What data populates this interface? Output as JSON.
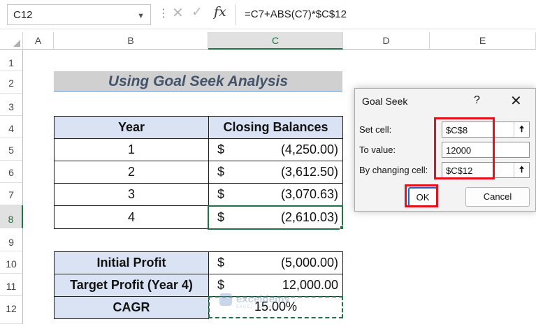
{
  "formula_bar": {
    "name_box": "C12",
    "fx": "fx",
    "formula": "=C7+ABS(C7)*$C$12"
  },
  "columns": [
    "A",
    "B",
    "C",
    "D",
    "E"
  ],
  "selected_column": "C",
  "rows": [
    "1",
    "2",
    "3",
    "4",
    "5",
    "6",
    "7",
    "8",
    "9",
    "10",
    "11",
    "12"
  ],
  "selected_row": "8",
  "title": "Using Goal Seek Analysis",
  "balance_table": {
    "headers": [
      "Year",
      "Closing Balances"
    ],
    "rows": [
      {
        "year": "1",
        "currency": "$",
        "balance": "(4,250.00)"
      },
      {
        "year": "2",
        "currency": "$",
        "balance": "(3,612.50)"
      },
      {
        "year": "3",
        "currency": "$",
        "balance": "(3,070.63)"
      },
      {
        "year": "4",
        "currency": "$",
        "balance": "(2,610.03)"
      }
    ]
  },
  "summary_table": {
    "rows": [
      {
        "label": "Initial Profit",
        "currency": "$",
        "value": "(5,000.00)"
      },
      {
        "label": "Target Profit (Year 4)",
        "currency": "$",
        "value": "12,000.00"
      },
      {
        "label": "CAGR",
        "currency": "",
        "value": "15.00%"
      }
    ]
  },
  "watermark": {
    "name": "exceldemy",
    "tagline": "EXCEL · DATA · BI"
  },
  "goal_seek_dialog": {
    "title": "Goal Seek",
    "help": "?",
    "close": "✕",
    "set_cell_label": "Set cell:",
    "set_cell_value": "$C$8",
    "to_value_label": "To value:",
    "to_value_value": "12000",
    "changing_cell_label": "By changing cell:",
    "changing_cell_value": "$C$12",
    "ok_label": "OK",
    "cancel_label": "Cancel"
  },
  "colors": {
    "header_fill": "#dae3f3",
    "title_fill": "#d0d0d0",
    "title_text": "#44546a",
    "selection": "#217346",
    "highlight": "#e5101a"
  },
  "icons": [
    "chevron-down-icon",
    "cancel-x-icon",
    "checkmark-icon",
    "function-icon",
    "collapse-dialog-icon",
    "close-icon",
    "help-icon"
  ]
}
